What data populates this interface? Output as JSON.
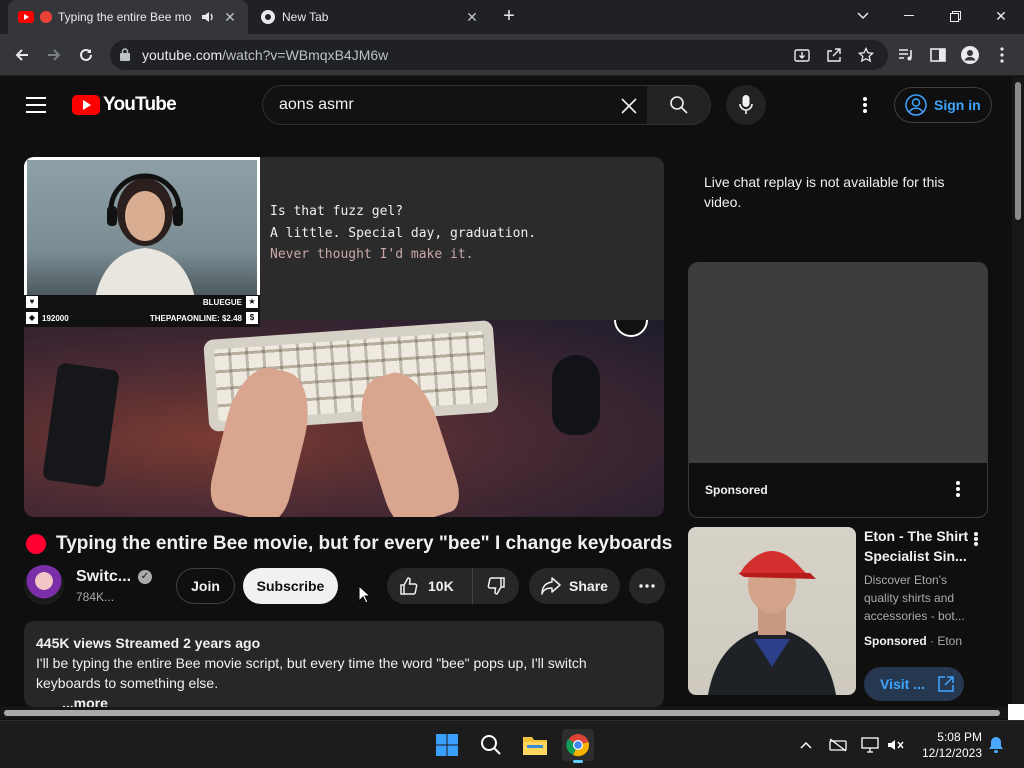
{
  "browser": {
    "tabs": [
      {
        "title": "Typing the entire Bee mo",
        "active": true,
        "audio": true
      },
      {
        "title": "New Tab",
        "active": false
      }
    ],
    "url_domain": "youtube.com",
    "url_path": "/watch?v=WBmqxB4JM6w"
  },
  "masthead": {
    "logo_text": "YouTube",
    "search_query": "aons asmr",
    "signin_label": "Sign in"
  },
  "player": {
    "subtitles": [
      {
        "text": "Is that fuzz gel?",
        "style": "normal"
      },
      {
        "text": "A little. Special day, graduation.",
        "style": "normal"
      },
      {
        "text": "Never thought I'd make it.",
        "style": "dim"
      }
    ],
    "overlay_left_top": "BLUEGUE",
    "overlay_left_bottom": "192000",
    "overlay_right_bottom": "THEPAPAONLINE: $2.48"
  },
  "video": {
    "title": "Typing the entire Bee movie, but for every \"bee\" I change keyboards",
    "channel_name": "Switc...",
    "subscribers": "784K...",
    "join_label": "Join",
    "subscribe_label": "Subscribe",
    "likes": "10K",
    "share_label": "Share",
    "views_line": "445K views  Streamed 2 years ago",
    "description": "I'll be typing the entire Bee movie script, but every time the word \"bee\" pops up, I'll switch keyboards to something else.",
    "more_label": "...more"
  },
  "sidebar": {
    "chat_note": "Live chat replay is not available for this video.",
    "ad_label": "Sponsored",
    "promo": {
      "title": "Eton - The Shirt Specialist Sin...",
      "description": "Discover Eton's quality shirts and accessories - bot...",
      "sponsored": "Sponsored",
      "advertiser": "Eton",
      "visit_label": "Visit ..."
    }
  },
  "taskbar": {
    "time": "5:08 PM",
    "date": "12/12/2023"
  },
  "colors": {
    "yt_red": "#ff0000",
    "link_blue": "#3ea6ff",
    "bg": "#0f0f0f"
  }
}
